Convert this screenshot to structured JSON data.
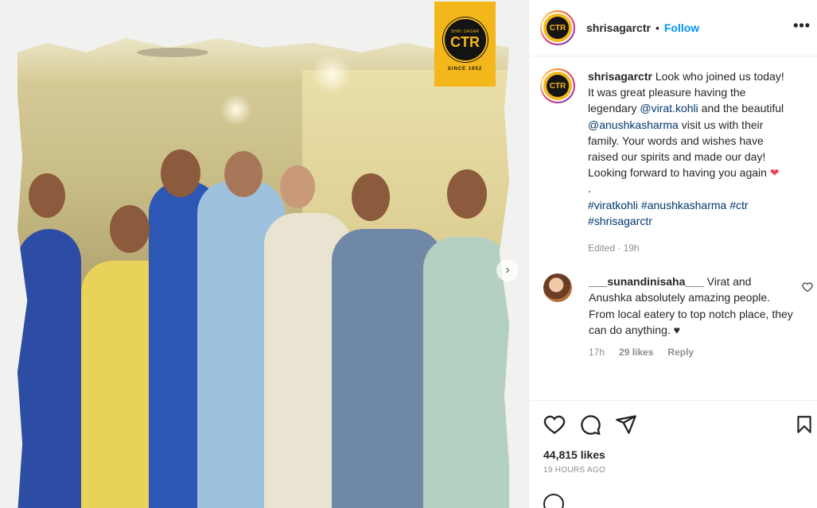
{
  "post": {
    "username": "shrisagarctr",
    "follow_label": "Follow",
    "separator": "•",
    "more_label": "•••",
    "logo_text": "CTR"
  },
  "media": {
    "badge_top": "SHRI SAGAR",
    "badge_main": "CTR",
    "badge_since": "SINCE 1952",
    "next_label": "›"
  },
  "caption": {
    "username": "shrisagarctr",
    "text_1": "Look who joined us today! It was great pleasure having the legendary ",
    "mention_1": "@virat.kohli",
    "text_2": " and the beautiful ",
    "mention_2": "@anushkasharma",
    "text_3": " visit us with their family. Your words and wishes have raised our spirits and made our day! Looking forward to having you again ",
    "heart": "❤",
    "dot_line": ".",
    "tags": [
      "#viratkohli",
      "#anushkasharma",
      "#ctr",
      "#shrisagarctr"
    ],
    "edited": "Edited · 19h"
  },
  "comment": {
    "username": "___sunandinisaha___",
    "text": "Virat and Anushka absolutely amazing people. From local eatery to top notch place, they can do anything. ♥",
    "time": "17h",
    "likes": "29 likes",
    "reply": "Reply"
  },
  "footer": {
    "likes": "44,815 likes",
    "time_ago": "19 HOURS AGO"
  },
  "colors": {
    "accent": "#0095f6",
    "badge": "#f4b71b",
    "mention": "#00376b",
    "heart": "#ed4956"
  },
  "icons": [
    "heart-icon",
    "comment-icon",
    "share-icon",
    "bookmark-icon",
    "more-icon",
    "next-arrow-icon"
  ]
}
